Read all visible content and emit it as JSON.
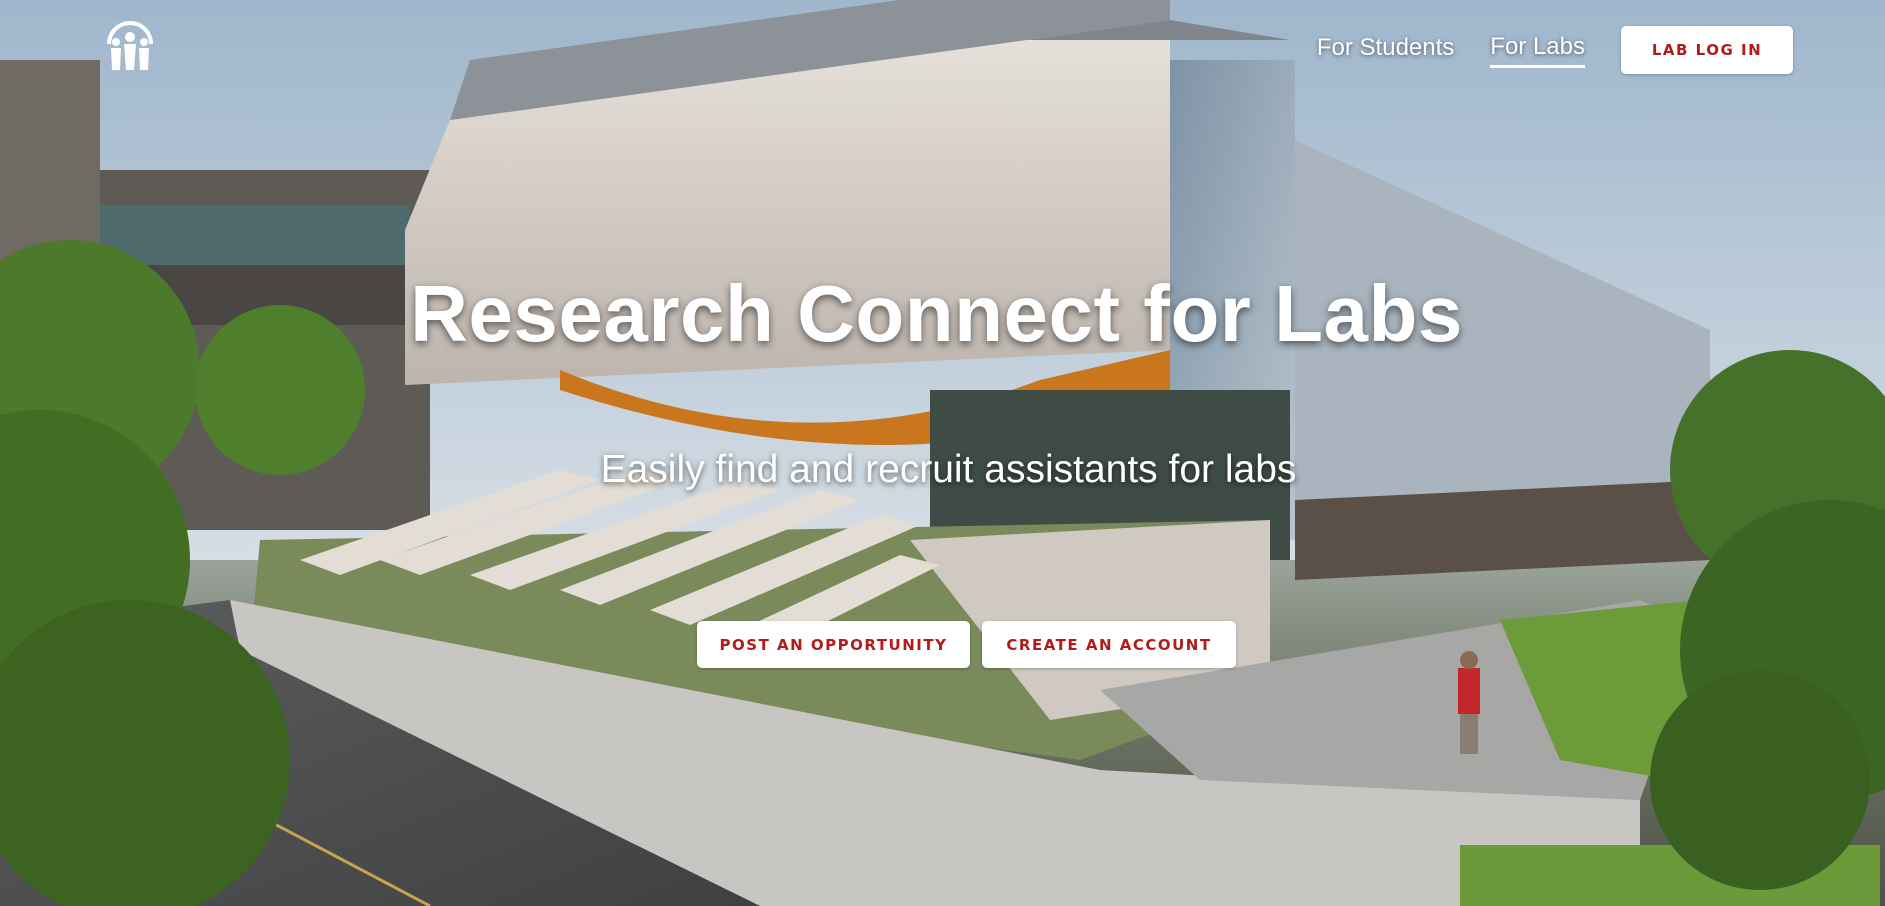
{
  "brand": {
    "logo_icon": "three-figures-logo-icon",
    "accent_color": "#b31b1b"
  },
  "nav": {
    "items": [
      {
        "label": "For Students",
        "active": false
      },
      {
        "label": "For Labs",
        "active": true
      }
    ],
    "login_label": "LAB LOG IN"
  },
  "hero": {
    "title": "Research Connect for Labs",
    "subtitle": "Easily find and recruit assistants for labs",
    "buttons": {
      "post_label": "POST AN OPPORTUNITY",
      "create_label": "CREATE AN ACCOUNT"
    },
    "background_image": "gates-hall-building-photo"
  }
}
